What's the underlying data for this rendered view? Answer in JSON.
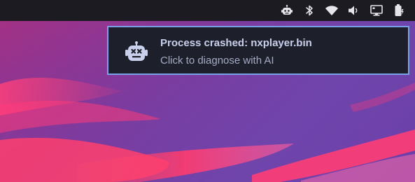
{
  "tray": {
    "icons": [
      "robot-icon",
      "bluetooth-icon",
      "wifi-icon",
      "volume-icon",
      "display-icon",
      "battery-icon"
    ]
  },
  "notification": {
    "icon": "robot-icon",
    "title": "Process crashed: nxplayer.bin",
    "body": "Click to diagnose with AI",
    "border_color": "#7aa2e8",
    "background_color": "#1d1f2b"
  },
  "colors": {
    "topbar": "#1c1b22",
    "tray_icon": "#e6e6ea"
  }
}
